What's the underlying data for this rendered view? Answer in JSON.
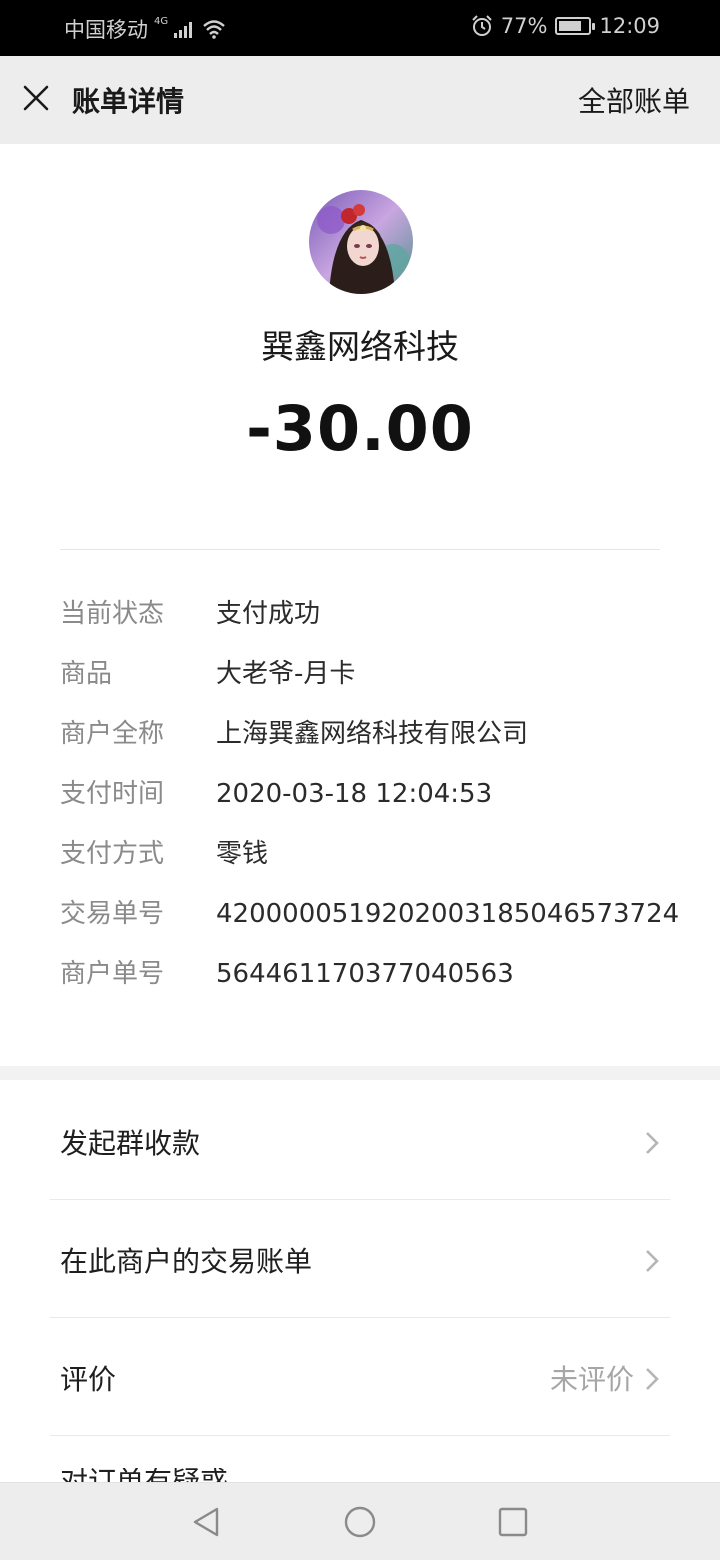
{
  "status_bar": {
    "carrier": "中国移动",
    "network": "4G",
    "battery_percent": "77%",
    "battery_level": 0.77,
    "time": "12:09"
  },
  "header": {
    "title": "账单详情",
    "right_link": "全部账单"
  },
  "merchant": {
    "name": "巽鑫网络科技",
    "amount": "-30.00"
  },
  "details": [
    {
      "label": "当前状态",
      "value": "支付成功"
    },
    {
      "label": "商品",
      "value": "大老爷-月卡"
    },
    {
      "label": "商户全称",
      "value": "上海巽鑫网络科技有限公司"
    },
    {
      "label": "支付时间",
      "value": "2020-03-18 12:04:53"
    },
    {
      "label": "支付方式",
      "value": "零钱"
    },
    {
      "label": "交易单号",
      "value": "4200000519202003185046573724"
    },
    {
      "label": "商户单号",
      "value": "564461170377040563"
    }
  ],
  "actions": [
    {
      "label": "发起群收款"
    },
    {
      "label": "在此商户的交易账单"
    },
    {
      "label": "评价",
      "extra": "未评价"
    }
  ],
  "partial_item": "对订单有疑惑",
  "icons": {
    "close": "close-icon",
    "alarm": "alarm-icon",
    "wifi": "wifi-icon",
    "signal": "signal-icon",
    "chevron": "chevron-right-icon",
    "nav_back": "nav-back-icon",
    "nav_home": "nav-home-icon",
    "nav_recent": "nav-recent-icon"
  }
}
